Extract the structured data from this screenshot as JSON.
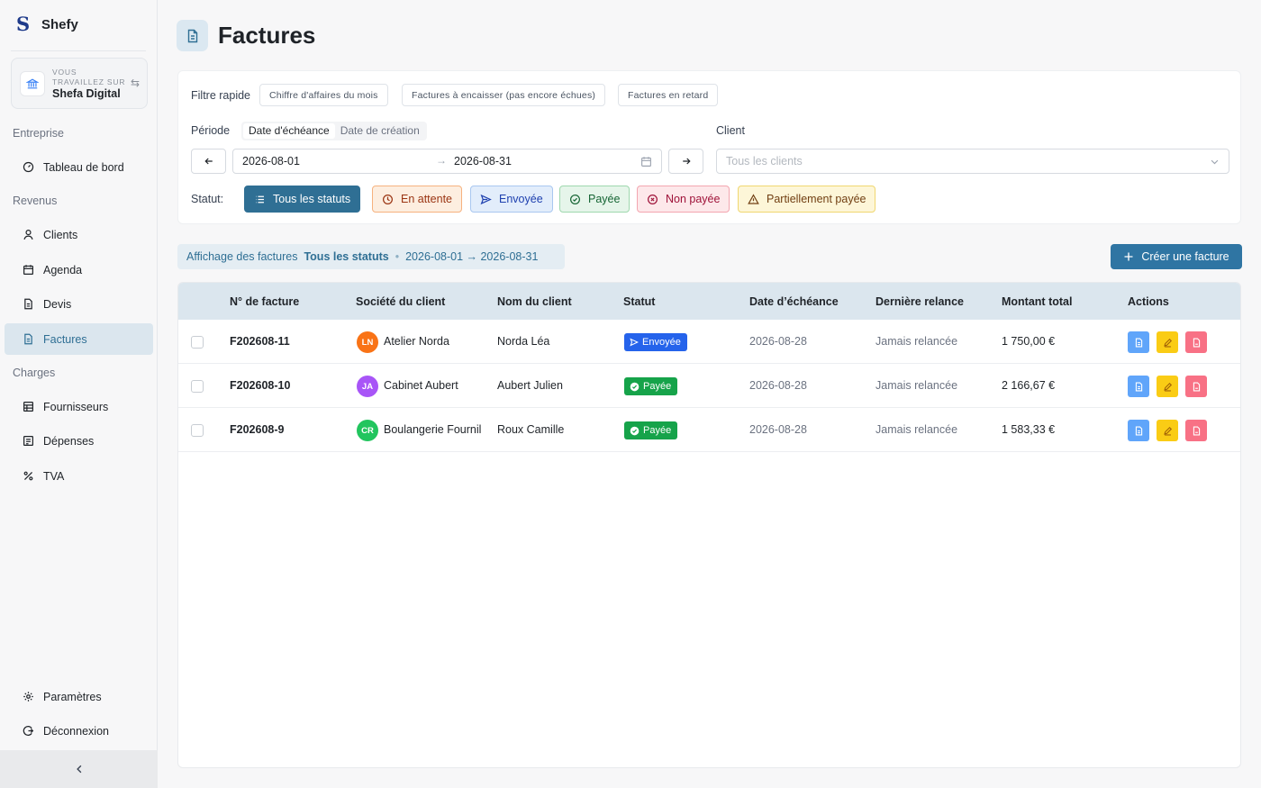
{
  "brand": {
    "name": "Shefy"
  },
  "workspace": {
    "label": "Vous travaillez sur",
    "name": "Shefa Digital"
  },
  "sidebar": {
    "sections": [
      {
        "title": "Entreprise",
        "items": [
          {
            "label": "Tableau de bord",
            "icon": "gauge-icon"
          }
        ]
      },
      {
        "title": "Revenus",
        "items": [
          {
            "label": "Clients",
            "icon": "user-icon"
          },
          {
            "label": "Agenda",
            "icon": "calendar-icon"
          },
          {
            "label": "Devis",
            "icon": "document-icon"
          },
          {
            "label": "Factures",
            "icon": "invoice-icon",
            "active": true
          }
        ]
      },
      {
        "title": "Charges",
        "items": [
          {
            "label": "Fournisseurs",
            "icon": "store-icon"
          },
          {
            "label": "Dépenses",
            "icon": "receipt-icon"
          },
          {
            "label": "TVA",
            "icon": "percent-icon"
          }
        ]
      }
    ],
    "footer": [
      {
        "label": "Paramètres",
        "icon": "gear-icon"
      },
      {
        "label": "Déconnexion",
        "icon": "logout-icon"
      }
    ]
  },
  "page": {
    "title": "Factures"
  },
  "filters": {
    "quick_label": "Filtre rapide",
    "quick": [
      "Chiffre d'affaires du mois",
      "Factures à encaisser (pas encore échues)",
      "Factures en retard"
    ],
    "period_label": "Période",
    "period_options": [
      "Date d'échéance",
      "Date de création"
    ],
    "period_selected": "Date d'échéance",
    "date_from": "2026-08-01",
    "date_to": "2026-08-31",
    "client_label": "Client",
    "client_placeholder": "Tous les clients",
    "status_label": "Statut:",
    "statuses": [
      "Tous les statuts",
      "En attente",
      "Envoyée",
      "Payée",
      "Non payée",
      "Partiellement payée"
    ]
  },
  "summary": {
    "prefix": "Affichage des factures",
    "status": "Tous les statuts",
    "sep": "•",
    "range": "2026-08-01 → 2026-08-31"
  },
  "create_button": "Créer une facture",
  "table": {
    "headers": [
      "N° de facture",
      "Société du client",
      "Nom du client",
      "Statut",
      "Date d’échéance",
      "Dernière relance",
      "Montant total",
      "Actions"
    ],
    "rows": [
      {
        "number": "F202608-11",
        "initials": "LN",
        "company": "Atelier Norda",
        "client": "Norda Léa",
        "status": "Envoyée",
        "due": "2026-08-28",
        "reminder": "Jamais relancée",
        "total": "1 750,00 €"
      },
      {
        "number": "F202608-10",
        "initials": "JA",
        "company": "Cabinet Aubert",
        "client": "Aubert Julien",
        "status": "Payée",
        "due": "2026-08-28",
        "reminder": "Jamais relancée",
        "total": "2 166,67 €"
      },
      {
        "number": "F202608-9",
        "initials": "CR",
        "company": "Boulangerie Fournil",
        "client": "Roux Camille",
        "status": "Payée",
        "due": "2026-08-28",
        "reminder": "Jamais relancée",
        "total": "1 583,33 €"
      }
    ]
  },
  "colors": {
    "primary": "#2f75a3",
    "active_nav_bg": "#dbe6ee",
    "badge_sent": "#2563eb",
    "badge_paid": "#16a34a",
    "avatar_ln": "#f97316",
    "avatar_ja": "#a855f7",
    "avatar_cr": "#22c55e"
  }
}
